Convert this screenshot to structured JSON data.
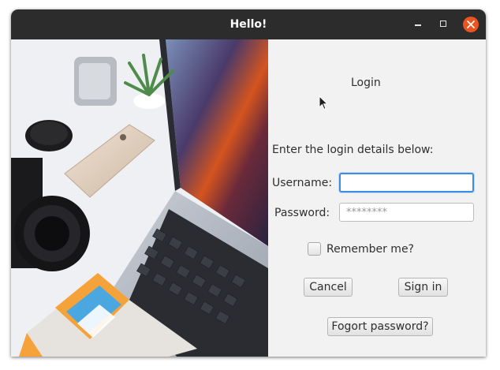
{
  "window": {
    "title": "Hello!"
  },
  "login": {
    "heading": "Login",
    "instructions": "Enter the login details below:",
    "username_label": "Username:",
    "username_value": "",
    "password_label": "Password:",
    "password_placeholder": "********",
    "remember_label": "Remember me?",
    "remember_checked": false,
    "cancel_label": "Cancel",
    "signin_label": "Sign in",
    "forgot_label": "Fogort password?"
  },
  "colors": {
    "titlebar": "#2c2c2c",
    "close_button": "#e95420",
    "focus_ring": "#3d8ee0",
    "panel": "#f2f2f2"
  }
}
